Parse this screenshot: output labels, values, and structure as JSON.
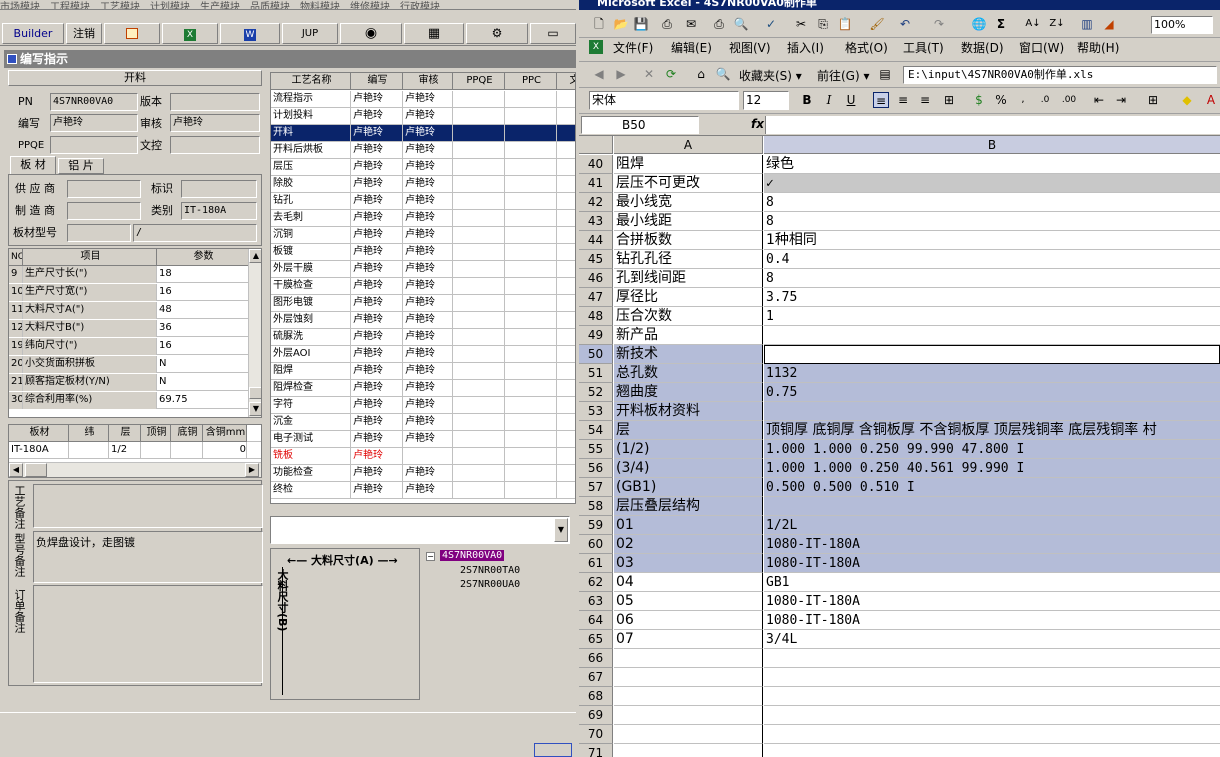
{
  "left": {
    "top_menu": [
      "市场模块",
      "工程模块",
      "工艺模块",
      "计划模块",
      "生产模块",
      "品质模块",
      "物料模块",
      "维修模块",
      "行政模块"
    ],
    "toolbar": {
      "builder": "Builder",
      "logout": "注销",
      "jup": "JUP"
    },
    "window_title": "编写指示",
    "panel_title": "开料",
    "fields": {
      "pn_label": "PN",
      "pn_value": "4S7NR00VA0",
      "version_label": "版本",
      "version_value": "",
      "writer_label": "编写",
      "writer_value": "卢艳玲",
      "review_label": "审核",
      "review_value": "卢艳玲",
      "ppqe_label": "PPQE",
      "ppqe_value": "",
      "doc_label": "文控",
      "doc_value": ""
    },
    "tabs": [
      "板 材",
      "铝 片"
    ],
    "board": {
      "supplier_label": "供 应 商",
      "mark_label": "标识",
      "maker_label": "制 造 商",
      "category_label": "类别",
      "category_value": "IT-180A",
      "model_label": "板材型号",
      "model_value": "/"
    },
    "params": {
      "headers": [
        "NO",
        "项目",
        "参数"
      ],
      "rows": [
        [
          "9",
          "生产尺寸长(\")",
          "18"
        ],
        [
          "10",
          "生产尺寸宽(\")",
          "16"
        ],
        [
          "11",
          "大料尺寸A(\")",
          "48"
        ],
        [
          "12",
          "大料尺寸B(\")",
          "36"
        ],
        [
          "19",
          "纬向尺寸(\")",
          "16"
        ],
        [
          "20",
          "小交货面积拼板",
          "N"
        ],
        [
          "21",
          "顾客指定板材(Y/N)",
          "N"
        ],
        [
          "30",
          "综合利用率(%)",
          "69.75"
        ]
      ]
    },
    "material": {
      "headers": [
        "板材",
        "纬",
        "层",
        "顶铜",
        "底铜",
        "含铜mm"
      ],
      "row": [
        "IT-180A",
        "",
        "1/2",
        "",
        "",
        "0"
      ]
    },
    "notes": {
      "process": "工艺备注",
      "model": "型号备注",
      "model_text": "负焊盘设计，走图镀",
      "order": "订单备注"
    },
    "process": {
      "headers": [
        "工艺名称",
        "编写",
        "审核",
        "PPQE",
        "PPC",
        "文"
      ],
      "rows": [
        [
          "流程指示",
          "卢艳玲",
          "卢艳玲"
        ],
        [
          "计划投料",
          "卢艳玲",
          "卢艳玲"
        ],
        [
          "开料",
          "卢艳玲",
          "卢艳玲"
        ],
        [
          "开料后烘板",
          "卢艳玲",
          "卢艳玲"
        ],
        [
          "层压",
          "卢艳玲",
          "卢艳玲"
        ],
        [
          "除胶",
          "卢艳玲",
          "卢艳玲"
        ],
        [
          "钻孔",
          "卢艳玲",
          "卢艳玲"
        ],
        [
          "去毛刺",
          "卢艳玲",
          "卢艳玲"
        ],
        [
          "沉铜",
          "卢艳玲",
          "卢艳玲"
        ],
        [
          "板镀",
          "卢艳玲",
          "卢艳玲"
        ],
        [
          "外层干膜",
          "卢艳玲",
          "卢艳玲"
        ],
        [
          "干膜检查",
          "卢艳玲",
          "卢艳玲"
        ],
        [
          "图形电镀",
          "卢艳玲",
          "卢艳玲"
        ],
        [
          "外层蚀刻",
          "卢艳玲",
          "卢艳玲"
        ],
        [
          "硫脲洗",
          "卢艳玲",
          "卢艳玲"
        ],
        [
          "外层AOI",
          "卢艳玲",
          "卢艳玲"
        ],
        [
          "阻焊",
          "卢艳玲",
          "卢艳玲"
        ],
        [
          "阻焊检查",
          "卢艳玲",
          "卢艳玲"
        ],
        [
          "字符",
          "卢艳玲",
          "卢艳玲"
        ],
        [
          "沉金",
          "卢艳玲",
          "卢艳玲"
        ],
        [
          "电子测试",
          "卢艳玲",
          "卢艳玲"
        ],
        [
          "铣板",
          "卢艳玲",
          ""
        ],
        [
          "功能检查",
          "卢艳玲",
          "卢艳玲"
        ],
        [
          "终检",
          "卢艳玲",
          "卢艳玲"
        ]
      ]
    },
    "diagram": {
      "a_label": "大料尺寸(A)",
      "b_label": "大料尺寸(B)"
    },
    "tree": [
      "4S7NR00VA0",
      "2S7NR00TA0",
      "2S7NR00UA0"
    ]
  },
  "excel": {
    "title": "Microsoft Excel - 4S7NR00VA0制作单",
    "menu": [
      "文件(F)",
      "编辑(E)",
      "视图(V)",
      "插入(I)",
      "格式(O)",
      "工具(T)",
      "数据(D)",
      "窗口(W)",
      "帮助(H)"
    ],
    "zoom": "100%",
    "favorites": "收藏夹(S)",
    "goto": "前往(G)",
    "path": "E:\\input\\4S7NR00VA0制作单.xls",
    "font": "宋体",
    "size": "12",
    "namebox": "B50",
    "fx": "fx",
    "col_a": "A",
    "col_b": "B",
    "rows": [
      {
        "n": "40",
        "a": "阻焊",
        "b": "绿色"
      },
      {
        "n": "41",
        "a": "层压不可更改",
        "b": "✓"
      },
      {
        "n": "42",
        "a": "最小线宽",
        "b": "8"
      },
      {
        "n": "43",
        "a": "最小线距",
        "b": "8"
      },
      {
        "n": "44",
        "a": "合拼板数",
        "b": "1种相同"
      },
      {
        "n": "45",
        "a": "钻孔孔径",
        "b": "0.4"
      },
      {
        "n": "46",
        "a": "孔到线间距",
        "b": "8"
      },
      {
        "n": "47",
        "a": "厚径比",
        "b": "3.75"
      },
      {
        "n": "48",
        "a": "压合次数",
        "b": "1"
      },
      {
        "n": "49",
        "a": "新产品",
        "b": ""
      },
      {
        "n": "50",
        "a": "新技术",
        "b": ""
      },
      {
        "n": "51",
        "a": "总孔数",
        "b": "1132"
      },
      {
        "n": "52",
        "a": "翘曲度",
        "b": "0.75"
      },
      {
        "n": "53",
        "a": "开料板材资料",
        "b": ""
      },
      {
        "n": "54",
        "a": "层",
        "b": "顶铜厚 底铜厚 含铜板厚 不含铜板厚 顶层残铜率 底层残铜率 村"
      },
      {
        "n": "55",
        "a": "(1/2)",
        "b": "1.000  1.000        0.250      99.990     47.800     I"
      },
      {
        "n": "56",
        "a": "(3/4)",
        "b": "1.000  1.000        0.250      40.561     99.990     I"
      },
      {
        "n": "57",
        "a": "(GB1)",
        "b": "0.500  0.500        0.510                            I"
      },
      {
        "n": "58",
        "a": "层压叠层结构",
        "b": ""
      },
      {
        "n": "59",
        "a": "01",
        "b": "1/2L"
      },
      {
        "n": "60",
        "a": "02",
        "b": "1080-IT-180A"
      },
      {
        "n": "61",
        "a": "03",
        "b": "1080-IT-180A"
      },
      {
        "n": "62",
        "a": "04",
        "b": "GB1"
      },
      {
        "n": "63",
        "a": "05",
        "b": "1080-IT-180A"
      },
      {
        "n": "64",
        "a": "06",
        "b": "1080-IT-180A"
      },
      {
        "n": "65",
        "a": "07",
        "b": "3/4L"
      },
      {
        "n": "66",
        "a": "",
        "b": ""
      },
      {
        "n": "67",
        "a": "",
        "b": ""
      },
      {
        "n": "68",
        "a": "",
        "b": ""
      },
      {
        "n": "69",
        "a": "",
        "b": ""
      },
      {
        "n": "70",
        "a": "",
        "b": ""
      },
      {
        "n": "71",
        "a": "",
        "b": ""
      }
    ]
  }
}
